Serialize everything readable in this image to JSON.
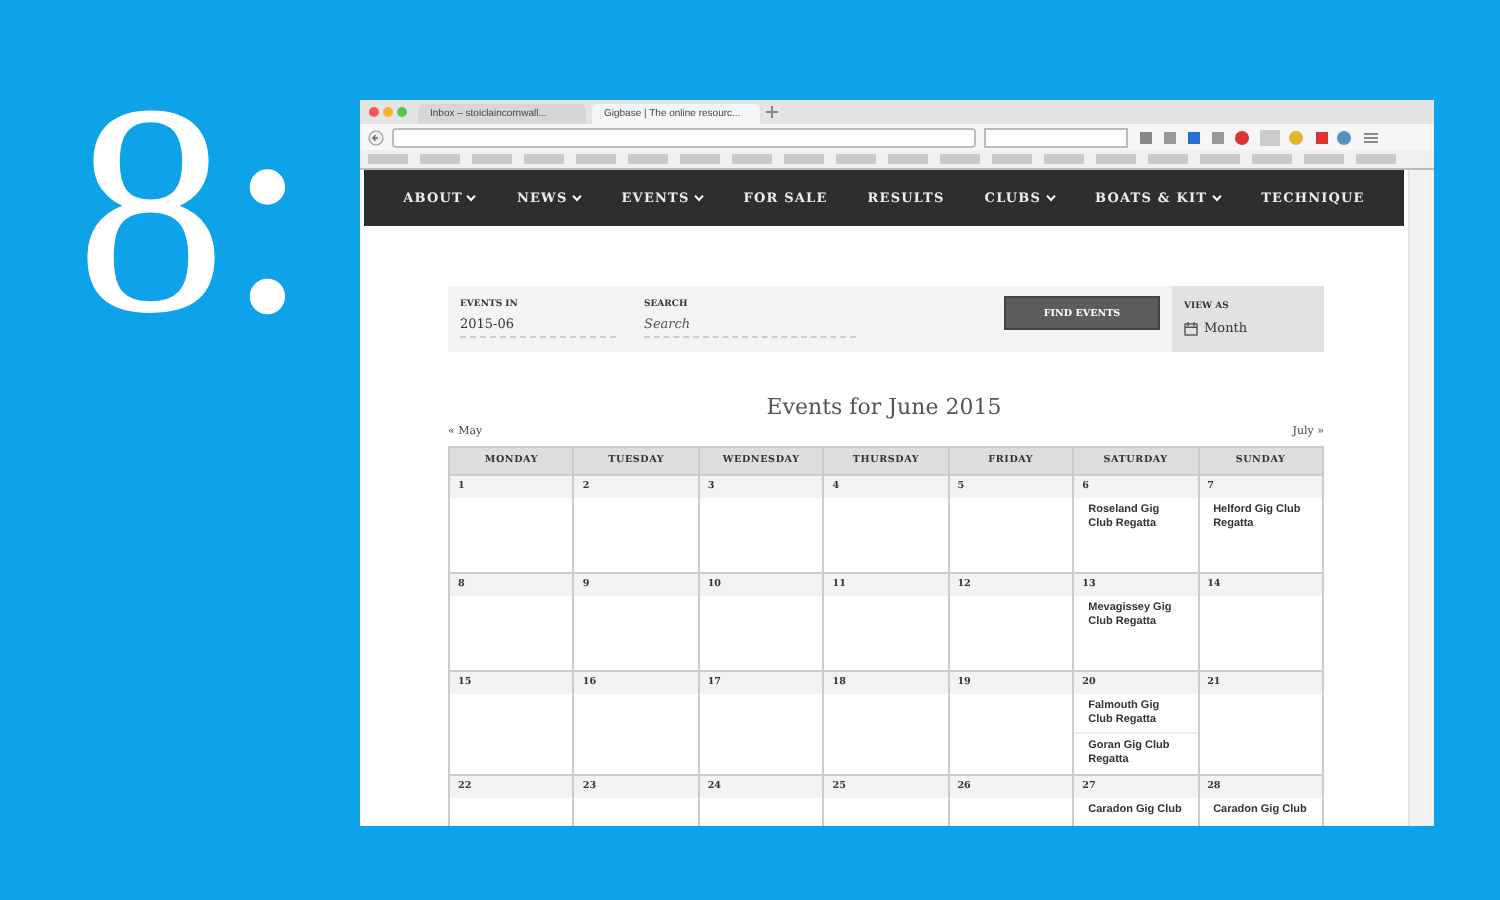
{
  "slide_number": "8:",
  "browser": {
    "tabs": [
      {
        "title": "Inbox – stoiclaincornwall...",
        "selected": false
      },
      {
        "title": "Gigbase | The online resourc...",
        "selected": true
      }
    ]
  },
  "nav": [
    {
      "label": "ABOUT",
      "dropdown": true
    },
    {
      "label": "NEWS",
      "dropdown": true
    },
    {
      "label": "EVENTS",
      "dropdown": true
    },
    {
      "label": "FOR SALE",
      "dropdown": false
    },
    {
      "label": "RESULTS",
      "dropdown": false
    },
    {
      "label": "CLUBS",
      "dropdown": true
    },
    {
      "label": "BOATS & KIT",
      "dropdown": true
    },
    {
      "label": "TECHNIQUE",
      "dropdown": false
    }
  ],
  "filters": {
    "events_in": {
      "label": "EVENTS IN",
      "value": "2015-06"
    },
    "search": {
      "label": "SEARCH",
      "placeholder": "Search"
    },
    "button": "FIND EVENTS",
    "view_as": {
      "label": "VIEW AS",
      "value": "Month"
    }
  },
  "calendar": {
    "title": "Events for June 2015",
    "prev": "« May",
    "next": "July »",
    "weekdays": [
      "MONDAY",
      "TUESDAY",
      "WEDNESDAY",
      "THURSDAY",
      "FRIDAY",
      "SATURDAY",
      "SUNDAY"
    ],
    "weeks": [
      [
        {
          "day": "1"
        },
        {
          "day": "2"
        },
        {
          "day": "3"
        },
        {
          "day": "4"
        },
        {
          "day": "5"
        },
        {
          "day": "6",
          "events": [
            "Roseland Gig Club Regatta"
          ]
        },
        {
          "day": "7",
          "events": [
            "Helford Gig Club Regatta"
          ]
        }
      ],
      [
        {
          "day": "8"
        },
        {
          "day": "9"
        },
        {
          "day": "10"
        },
        {
          "day": "11"
        },
        {
          "day": "12"
        },
        {
          "day": "13",
          "events": [
            "Mevagissey Gig Club Regatta"
          ]
        },
        {
          "day": "14"
        }
      ],
      [
        {
          "day": "15"
        },
        {
          "day": "16"
        },
        {
          "day": "17"
        },
        {
          "day": "18"
        },
        {
          "day": "19"
        },
        {
          "day": "20",
          "events": [
            "Falmouth Gig Club Regatta",
            "Goran Gig Club Regatta"
          ]
        },
        {
          "day": "21"
        }
      ],
      [
        {
          "day": "22"
        },
        {
          "day": "23"
        },
        {
          "day": "24"
        },
        {
          "day": "25"
        },
        {
          "day": "26"
        },
        {
          "day": "27",
          "events": [
            "Caradon Gig Club"
          ]
        },
        {
          "day": "28",
          "events": [
            "Caradon Gig Club"
          ]
        }
      ]
    ]
  }
}
